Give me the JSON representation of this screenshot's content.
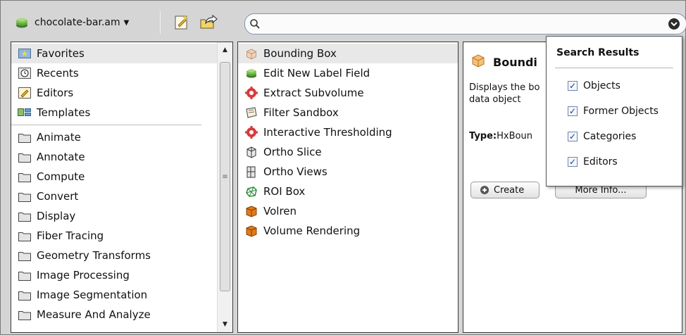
{
  "toolbar": {
    "project_name": "chocolate-bar.am",
    "search_value": "",
    "icons": [
      "project-stack-icon",
      "new-script-icon",
      "export-icon",
      "search-icon",
      "search-options-icon"
    ]
  },
  "categories": {
    "pinned": [
      {
        "label": "Favorites",
        "icon": "favorites-star-icon"
      },
      {
        "label": "Recents",
        "icon": "recents-clock-icon"
      },
      {
        "label": "Editors",
        "icon": "editors-pencil-icon"
      },
      {
        "label": "Templates",
        "icon": "templates-icon"
      }
    ],
    "folders": [
      {
        "label": "Animate"
      },
      {
        "label": "Annotate"
      },
      {
        "label": "Compute"
      },
      {
        "label": "Convert"
      },
      {
        "label": "Display"
      },
      {
        "label": "Fiber Tracing"
      },
      {
        "label": "Geometry Transforms"
      },
      {
        "label": "Image Processing"
      },
      {
        "label": "Image Segmentation"
      },
      {
        "label": "Measure And Analyze"
      }
    ]
  },
  "modules": [
    {
      "label": "Bounding Box",
      "icon": "bounding-box-icon"
    },
    {
      "label": "Edit New Label Field",
      "icon": "stack-icon"
    },
    {
      "label": "Extract Subvolume",
      "icon": "gear-red-icon"
    },
    {
      "label": "Filter Sandbox",
      "icon": "sandbox-icon"
    },
    {
      "label": "Interactive Thresholding",
      "icon": "gear-red-icon"
    },
    {
      "label": "Ortho Slice",
      "icon": "ortho-slice-icon"
    },
    {
      "label": "Ortho Views",
      "icon": "ortho-views-icon"
    },
    {
      "label": "ROI Box",
      "icon": "roi-box-icon"
    },
    {
      "label": "Volren",
      "icon": "volume-cube-icon"
    },
    {
      "label": "Volume Rendering",
      "icon": "volume-cube-icon"
    }
  ],
  "detail": {
    "title": "Boundi",
    "description_line1": "Displays the bo",
    "description_line2": "data object",
    "type_label": "Type:",
    "type_value": "HxBoun",
    "create_label": "Create",
    "more_info_label": "More Info..."
  },
  "search_results": {
    "title": "Search Results",
    "options": [
      {
        "label": "Objects",
        "checked": true
      },
      {
        "label": "Former Objects",
        "checked": true
      },
      {
        "label": "Categories",
        "checked": true
      },
      {
        "label": "Editors",
        "checked": true
      }
    ]
  },
  "colors": {
    "accent": "#7d96b8",
    "volume_orange": "#e07a1c",
    "gear_red": "#d83a3a"
  }
}
